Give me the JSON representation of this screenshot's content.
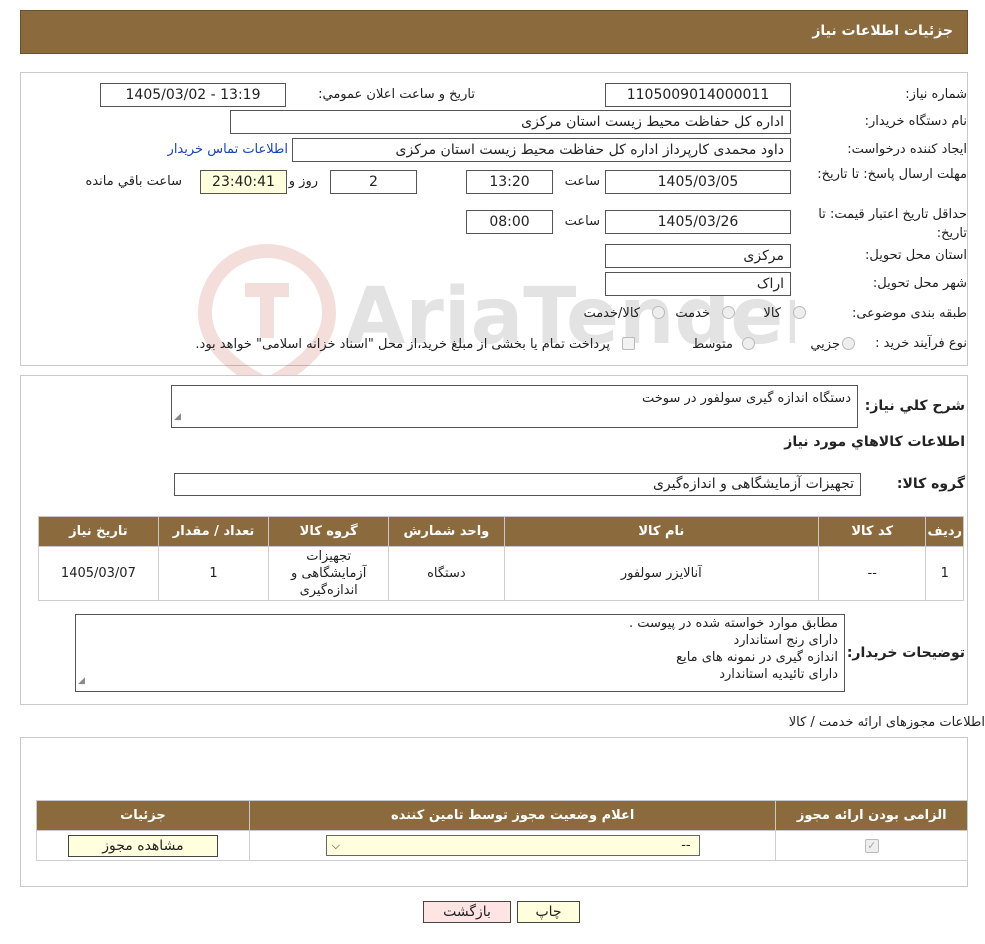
{
  "header": {
    "title": "جزئیات اطلاعات نیاز"
  },
  "info": {
    "need_number_label": "شماره نیاز:",
    "need_number": "1105009014000011",
    "announce_label": "تاریخ و ساعت اعلان عمومي:",
    "announce_value": "1405/03/02 - 13:19",
    "buyer_org_label": "نام دستگاه خریدار:",
    "buyer_org": "اداره کل حفاظت محیط زیست استان مرکزی",
    "creator_label": "ایجاد کننده درخواست:",
    "creator": "داود محمدی کارپرداز اداره کل حفاظت محیط زیست استان مرکزی",
    "contact_link": "اطلاعات تماس خریدار",
    "deadline_label": "مهلت ارسال پاسخ: تا تاریخ:",
    "deadline_date": "1405/03/05",
    "time_label": "ساعت",
    "deadline_time": "13:20",
    "days_value": "2",
    "days_label": "روز و",
    "remaining_time": "23:40:41",
    "remaining_label": "ساعت باقي مانده",
    "validity_label": "حداقل تاریخ اعتبار قیمت: تا تاریخ:",
    "validity_date": "1405/03/26",
    "validity_time": "08:00",
    "province_label": "استان محل تحویل:",
    "province": "مرکزی",
    "city_label": "شهر محل تحویل:",
    "city": "اراک",
    "category_label": "طبقه بندی موضوعی:",
    "category_options": [
      "کالا",
      "خدمت",
      "کالا/خدمت"
    ],
    "process_label": "نوع فرآیند خرید :",
    "process_options": [
      "جزیي",
      "متوسط"
    ],
    "payment_note": "پرداخت تمام یا بخشی از مبلغ خرید،از محل \"اسناد خزانه اسلامی\" خواهد بود."
  },
  "details": {
    "summary_label": "شرح کلي نیاز:",
    "summary": "دستگاه اندازه گیری سولفور در سوخت",
    "goods_info_title": "اطلاعات کالاهاي مورد نیاز",
    "group_label": "گروه کالا:",
    "group": "تجهیزات آزمایشگاهی و اندازه‌گیری",
    "table": {
      "headers": [
        "ردیف",
        "کد کالا",
        "نام کالا",
        "واحد شمارش",
        "گروه کالا",
        "تعداد / مقدار",
        "تاریخ نیاز"
      ],
      "rows": [
        [
          "1",
          "--",
          "آنالایزر سولفور",
          "دستگاه",
          "تجهیزات آزمایشگاهی و اندازه‌گیری",
          "1",
          "1405/03/07"
        ]
      ]
    },
    "buyer_notes_label": "توضیحات خریدار:",
    "buyer_notes": [
      "مطابق موارد خواسته شده در پیوست .",
      "دارای رنج استاندارد",
      "اندازه گیری در نمونه های مایع",
      "دارای تائیدیه استاندارد"
    ]
  },
  "permits": {
    "title": "اطلاعات مجوزهای ارائه خدمت / کالا",
    "headers": [
      "الزامی بودن ارائه مجوز",
      "اعلام وضعیت مجوز توسط تامین کننده",
      "جزئیات"
    ],
    "select_value": "--",
    "view_button": "مشاهده مجوز"
  },
  "buttons": {
    "print": "چاپ",
    "back": "بازگشت"
  },
  "colors": {
    "header_bg": "#8b6a3e",
    "input_highlight": "#ffffdd",
    "link": "#1a43b8"
  }
}
